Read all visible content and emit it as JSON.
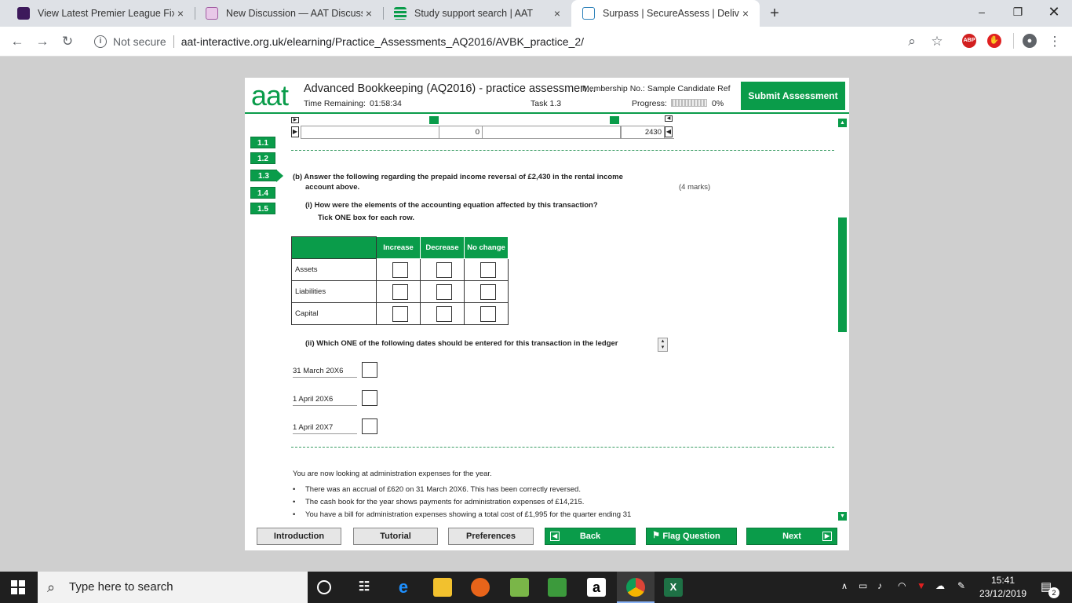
{
  "browser": {
    "tabs": [
      {
        "title": "View Latest Premier League Fixtu",
        "favicon_color": "#3d195b"
      },
      {
        "title": "New Discussion — AAT Discussio",
        "favicon_color": "#a05aa0"
      },
      {
        "title": "Study support search | AAT",
        "favicon_color": "#0a9c4a"
      },
      {
        "title": "Surpass | SecureAssess | Delivery",
        "favicon_color": "#2a7fb8"
      }
    ],
    "close_glyph": "×",
    "new_tab_glyph": "+",
    "security_label": "Not secure",
    "url": "aat-interactive.org.uk/elearning/Practice_Assessments_AQ2016/AVBK_practice_2/",
    "abp_badge": "ABP"
  },
  "assessment": {
    "logo": "aat",
    "title": "Advanced Bookkeeping (AQ2016) - practice assessmen...",
    "membership": "Membership No.: Sample Candidate Ref",
    "time_label": "Time Remaining:",
    "time_value": "01:58:34",
    "task_label": "Task 1.3",
    "progress_label": "Progress:",
    "progress_value": "0%",
    "progress_fraction": 0,
    "submit_label": "Submit Assessment",
    "tasks": [
      "1.1",
      "1.2",
      "1.3",
      "1.4",
      "1.5"
    ],
    "current_task": "1.3",
    "ledger_values": {
      "left": "0",
      "right": "2430"
    },
    "question_b": "(b) Answer the following regarding the prepaid income reversal of £2,430 in the rental income",
    "question_b_cont": "account above.",
    "marks": "(4 marks)",
    "question_i": "(i) How were the elements of the accounting equation affected by this transaction?",
    "question_i_instr": "Tick ONE box for each row.",
    "equation_table": {
      "headers": [
        "Increase",
        "Decrease",
        "No change"
      ],
      "rows": [
        "Assets",
        "Liabilities",
        "Capital"
      ]
    },
    "question_ii": "(ii) Which ONE of the following dates should be entered for this transaction in the ledger",
    "date_options": [
      "31 March 20X6",
      "1 April 20X6",
      "1 April 20X7"
    ],
    "admin_intro": "You are now looking at administration expenses for the year.",
    "admin_bullets": [
      "There was an accrual of £620 on 31 March 20X6. This has been correctly reversed.",
      "The cash book for the year shows payments for administration expenses of £14,215.",
      "You have a bill for administration expenses showing a total cost of £1,995 for the quarter ending 31"
    ],
    "footer": {
      "introduction": "Introduction",
      "tutorial": "Tutorial",
      "preferences": "Preferences",
      "back": "Back",
      "flag": "Flag Question",
      "next": "Next"
    }
  },
  "taskbar": {
    "search_placeholder": "Type here to search",
    "time": "15:41",
    "date": "23/12/2019",
    "notification_count": "2"
  },
  "colors": {
    "accent": "#0a9c4a"
  }
}
